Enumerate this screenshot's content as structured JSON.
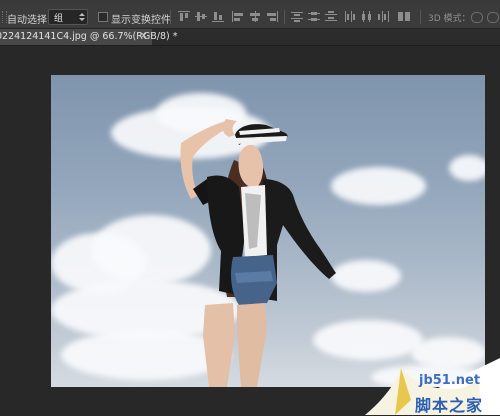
{
  "optionsbar": {
    "auto_select_label": "自动选择：",
    "auto_select_value": "组",
    "show_transform_label": "显示变换控件",
    "mode_3d_label": "3D 模式："
  },
  "tabbar": {
    "document_title": "0224124141C4.jpg @ 66.7%(RGB/8) *",
    "close_glyph": "×"
  },
  "watermark": {
    "site": "jb51.net",
    "name": "脚本之家"
  },
  "colors": {
    "options_bar": "#3b3b3b",
    "workspace": "#282828",
    "watermark_blue": "#2c5fb3"
  }
}
